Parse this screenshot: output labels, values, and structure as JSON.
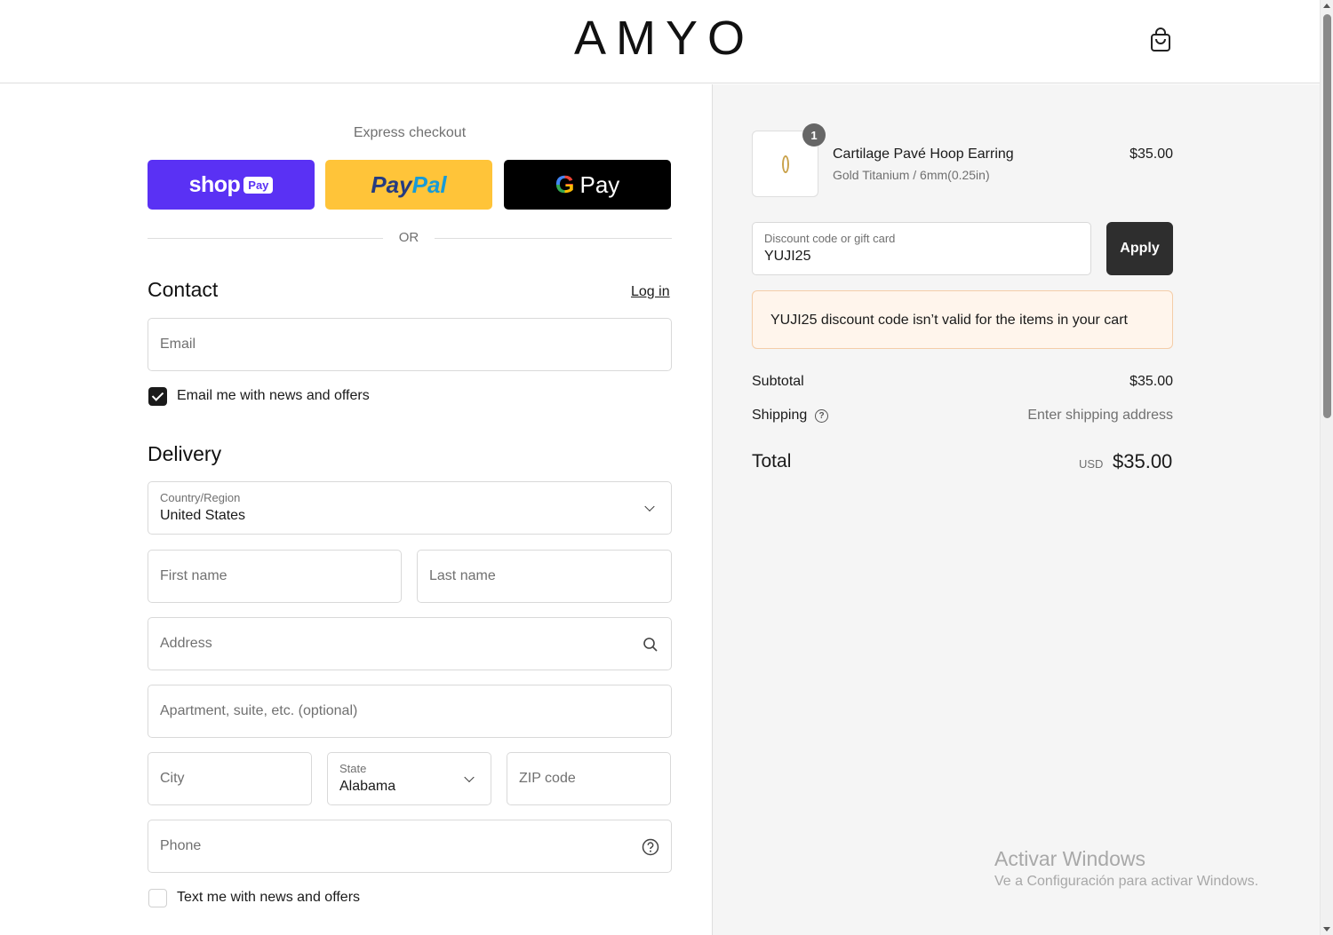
{
  "header": {
    "logo": "AMYO",
    "cart_icon": "shopping-bag-icon"
  },
  "express": {
    "title": "Express checkout",
    "shop_pay": {
      "word": "shop",
      "badge": "Pay"
    },
    "paypal": {
      "pay": "Pay",
      "pal": "Pal"
    },
    "gpay": {
      "g": "G",
      "word": "Pay"
    },
    "divider": "OR"
  },
  "contact": {
    "title": "Contact",
    "login": "Log in",
    "email_placeholder": "Email",
    "news_label": "Email me with news and offers",
    "news_checked": true
  },
  "delivery": {
    "title": "Delivery",
    "country_label": "Country/Region",
    "country_value": "United States",
    "first_name": "First name",
    "last_name": "Last name",
    "address": "Address",
    "apartment": "Apartment, suite, etc. (optional)",
    "city": "City",
    "state_label": "State",
    "state_value": "Alabama",
    "zip": "ZIP code",
    "phone": "Phone",
    "sms_label": "Text me with news and offers",
    "sms_checked": false
  },
  "summary": {
    "item": {
      "quantity": "1",
      "name": "Cartilage Pavé Hoop Earring",
      "variant": "Gold Titanium / 6mm(0.25in)",
      "price": "$35.00"
    },
    "discount": {
      "label": "Discount code or gift card",
      "value": "YUJI25",
      "apply": "Apply",
      "error": "YUJI25 discount code isn’t valid for the items in your cart"
    },
    "subtotal_label": "Subtotal",
    "subtotal_value": "$35.00",
    "shipping_label": "Shipping",
    "shipping_value": "Enter shipping address",
    "total_label": "Total",
    "currency": "USD",
    "total_value": "$35.00"
  },
  "watermark": {
    "title": "Activar Windows",
    "subtitle": "Ve a Configuración para activar Windows."
  },
  "colors": {
    "shop_pay": "#5a31f4",
    "paypal": "#ffc439",
    "gpay": "#000000",
    "apply": "#2e2e2e",
    "error_bg": "#fff5ec",
    "error_border": "#f4cda8"
  }
}
